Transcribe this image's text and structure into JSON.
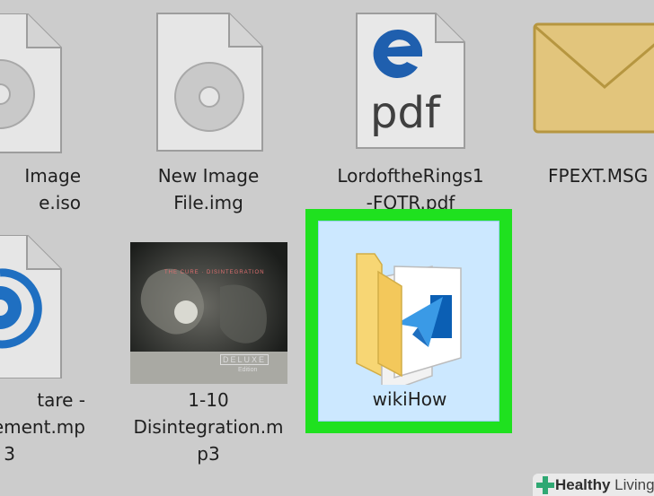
{
  "files": [
    {
      "name": "iso-file",
      "lines": [
        "Image",
        "e.iso"
      ],
      "icon": "disc-image-icon"
    },
    {
      "name": "new-image-file",
      "lines": [
        "New Image",
        "File.img"
      ],
      "icon": "disc-image-icon"
    },
    {
      "name": "pdf-file",
      "lines": [
        "LordoftheRings1",
        "-FOTR.pdf"
      ],
      "icon": "edge-pdf-icon",
      "icon_text": "pdf"
    },
    {
      "name": "msg-file",
      "lines": [
        "FPEXT.MSG"
      ],
      "icon": "envelope-icon"
    },
    {
      "name": "mp3-file",
      "lines": [
        "tare -",
        "ement.mp",
        "3"
      ],
      "icon": "media-player-icon"
    },
    {
      "name": "disintegration-mp3",
      "lines": [
        "1-10",
        "Disintegration.m",
        "p3"
      ],
      "icon": "album-art-thumbnail",
      "album_top_text": "THE CURE · DISINTEGRATION",
      "album_bottom_text": "DELUXE",
      "album_edition": "Edition"
    },
    {
      "name": "wikihow-folder",
      "lines": [
        "wikiHow"
      ],
      "icon": "folder-icon",
      "selected": true
    }
  ],
  "watermark": {
    "bold": "Healthy",
    "rest": " Living"
  },
  "colors": {
    "selection_highlight": "#1fe11f",
    "selected_bg": "#cce8ff",
    "edge_blue": "#1f5fae",
    "folder_yellow": "#f7d674"
  }
}
